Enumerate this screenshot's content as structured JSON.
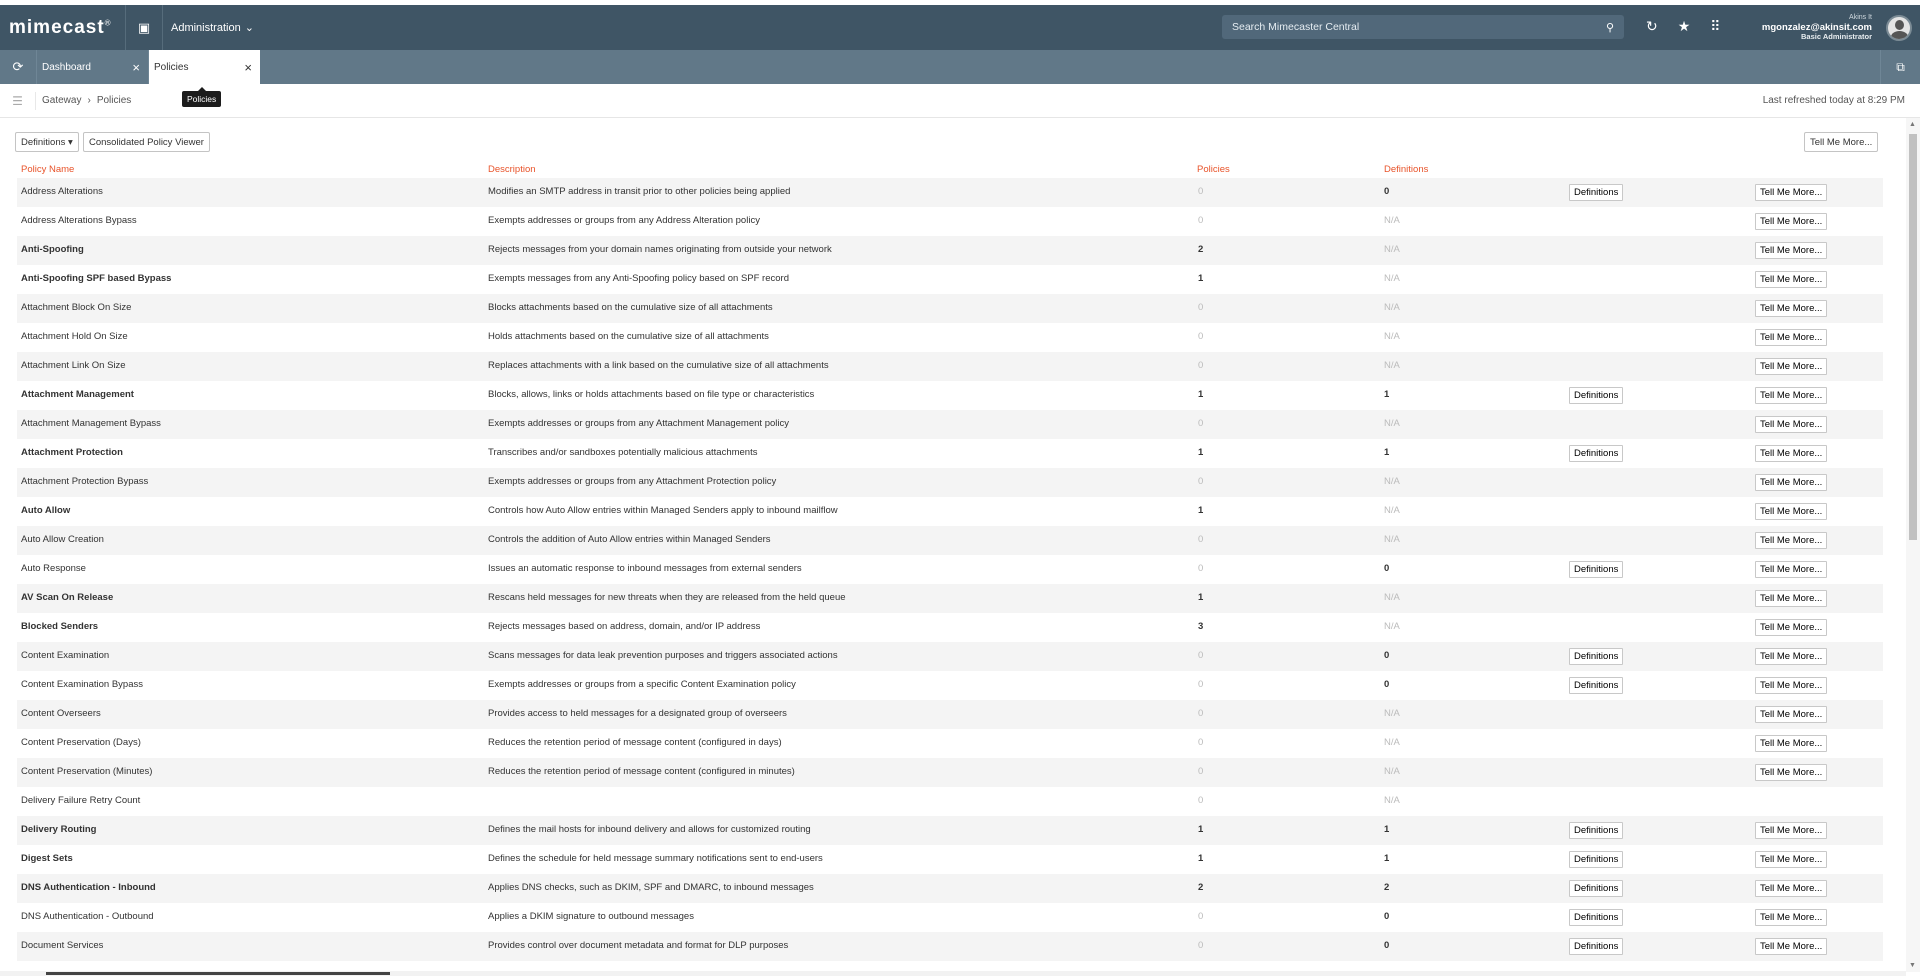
{
  "app": {
    "logo": "mimecast",
    "section": "Administration",
    "search_placeholder": "Search Mimecaster Central",
    "user": {
      "name": "Akins It",
      "email": "mgonzalez@akinsit.com",
      "role": "Basic Administrator"
    }
  },
  "tabs": [
    {
      "label": "Dashboard",
      "active": false
    },
    {
      "label": "Policies",
      "active": true
    }
  ],
  "tooltip": "Policies",
  "breadcrumb": {
    "parent": "Gateway",
    "separator": "›",
    "current": "Policies"
  },
  "last_refreshed": "Last refreshed today at 8:29 PM",
  "toolbar": {
    "definitions": "Definitions ▾",
    "viewer": "Consolidated Policy Viewer",
    "tell_me_more": "Tell Me More..."
  },
  "table": {
    "headers": {
      "name": "Policy Name",
      "description": "Description",
      "policies": "Policies",
      "definitions": "Definitions"
    },
    "def_button": "Definitions",
    "tell_button": "Tell Me More...",
    "rows": [
      {
        "name": "Address Alterations",
        "description": "Modifies an SMTP address in transit prior to other policies being applied",
        "policies": "0",
        "definitions": "0",
        "has_def_button": true,
        "has_tell": true
      },
      {
        "name": "Address Alterations Bypass",
        "description": "Exempts addresses or groups from any Address Alteration policy",
        "policies": "0",
        "definitions": "N/A",
        "has_def_button": false,
        "has_tell": true
      },
      {
        "name": "Anti-Spoofing",
        "description": "Rejects messages from your domain names originating from outside your network",
        "policies": "2",
        "definitions": "N/A",
        "has_def_button": false,
        "has_tell": true
      },
      {
        "name": "Anti-Spoofing SPF based Bypass",
        "description": "Exempts messages from any Anti-Spoofing policy based on SPF record",
        "policies": "1",
        "definitions": "N/A",
        "has_def_button": false,
        "has_tell": true
      },
      {
        "name": "Attachment Block On Size",
        "description": "Blocks attachments based on the cumulative size of all attachments",
        "policies": "0",
        "definitions": "N/A",
        "has_def_button": false,
        "has_tell": true
      },
      {
        "name": "Attachment Hold On Size",
        "description": "Holds attachments based on the cumulative size of all attachments",
        "policies": "0",
        "definitions": "N/A",
        "has_def_button": false,
        "has_tell": true
      },
      {
        "name": "Attachment Link On Size",
        "description": "Replaces attachments with a link based on the cumulative size of all attachments",
        "policies": "0",
        "definitions": "N/A",
        "has_def_button": false,
        "has_tell": true
      },
      {
        "name": "Attachment Management",
        "description": "Blocks, allows, links or holds attachments based on file type or characteristics",
        "policies": "1",
        "definitions": "1",
        "has_def_button": true,
        "has_tell": true
      },
      {
        "name": "Attachment Management Bypass",
        "description": "Exempts addresses or groups from any Attachment Management policy",
        "policies": "0",
        "definitions": "N/A",
        "has_def_button": false,
        "has_tell": true
      },
      {
        "name": "Attachment Protection",
        "description": "Transcribes and/or sandboxes potentially malicious attachments",
        "policies": "1",
        "definitions": "1",
        "has_def_button": true,
        "has_tell": true
      },
      {
        "name": "Attachment Protection Bypass",
        "description": "Exempts addresses or groups from any Attachment Protection policy",
        "policies": "0",
        "definitions": "N/A",
        "has_def_button": false,
        "has_tell": true
      },
      {
        "name": "Auto Allow",
        "description": "Controls how Auto Allow entries within Managed Senders apply to inbound mailflow",
        "policies": "1",
        "definitions": "N/A",
        "has_def_button": false,
        "has_tell": true
      },
      {
        "name": "Auto Allow Creation",
        "description": "Controls the addition of Auto Allow entries within Managed Senders",
        "policies": "0",
        "definitions": "N/A",
        "has_def_button": false,
        "has_tell": true
      },
      {
        "name": "Auto Response",
        "description": "Issues an automatic response to inbound messages from external senders",
        "policies": "0",
        "definitions": "0",
        "has_def_button": true,
        "has_tell": true
      },
      {
        "name": "AV Scan On Release",
        "description": "Rescans held messages for new threats when they are released from the held queue",
        "policies": "1",
        "definitions": "N/A",
        "has_def_button": false,
        "has_tell": true
      },
      {
        "name": "Blocked Senders",
        "description": "Rejects messages based on address, domain, and/or IP address",
        "policies": "3",
        "definitions": "N/A",
        "has_def_button": false,
        "has_tell": true
      },
      {
        "name": "Content Examination",
        "description": "Scans messages for data leak prevention purposes and triggers associated actions",
        "policies": "0",
        "definitions": "0",
        "has_def_button": true,
        "has_tell": true
      },
      {
        "name": "Content Examination Bypass",
        "description": "Exempts addresses or groups from a specific Content Examination policy",
        "policies": "0",
        "definitions": "0",
        "has_def_button": true,
        "has_tell": true
      },
      {
        "name": "Content Overseers",
        "description": "Provides access to held messages for a designated group of overseers",
        "policies": "0",
        "definitions": "N/A",
        "has_def_button": false,
        "has_tell": true
      },
      {
        "name": "Content Preservation (Days)",
        "description": "Reduces the retention period of message content (configured in days)",
        "policies": "0",
        "definitions": "N/A",
        "has_def_button": false,
        "has_tell": true
      },
      {
        "name": "Content Preservation (Minutes)",
        "description": "Reduces the retention period of message content (configured in minutes)",
        "policies": "0",
        "definitions": "N/A",
        "has_def_button": false,
        "has_tell": true
      },
      {
        "name": "Delivery Failure Retry Count",
        "description": "",
        "policies": "0",
        "definitions": "N/A",
        "has_def_button": false,
        "has_tell": false
      },
      {
        "name": "Delivery Routing",
        "description": "Defines the mail hosts for inbound delivery and allows for customized routing",
        "policies": "1",
        "definitions": "1",
        "has_def_button": true,
        "has_tell": true
      },
      {
        "name": "Digest Sets",
        "description": "Defines the schedule for held message summary notifications sent to end-users",
        "policies": "1",
        "definitions": "1",
        "has_def_button": true,
        "has_tell": true
      },
      {
        "name": "DNS Authentication - Inbound",
        "description": "Applies DNS checks, such as DKIM, SPF and DMARC, to inbound messages",
        "policies": "2",
        "definitions": "2",
        "has_def_button": true,
        "has_tell": true
      },
      {
        "name": "DNS Authentication - Outbound",
        "description": "Applies a DKIM signature to outbound messages",
        "policies": "0",
        "definitions": "0",
        "has_def_button": true,
        "has_tell": true
      },
      {
        "name": "Document Services",
        "description": "Provides control over document metadata and format for DLP purposes",
        "policies": "0",
        "definitions": "0",
        "has_def_button": true,
        "has_tell": true
      }
    ]
  }
}
